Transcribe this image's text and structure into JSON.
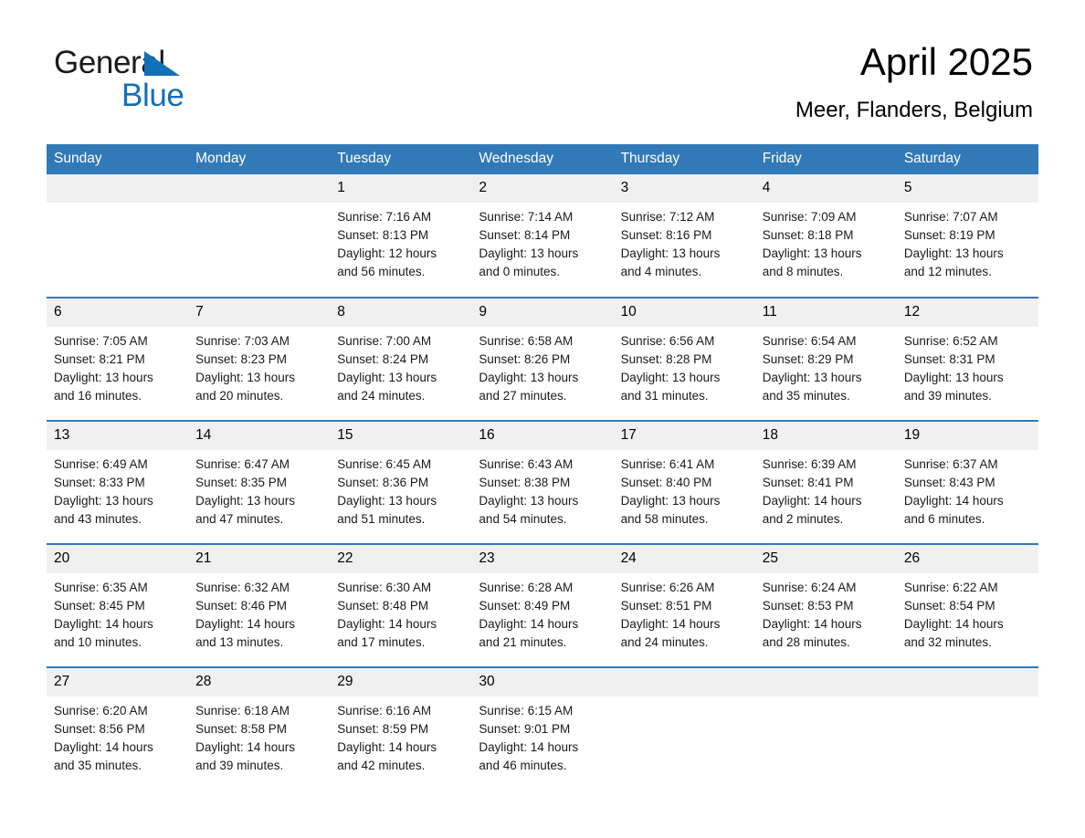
{
  "brand": {
    "logo_line1": "General",
    "logo_line2": "Blue",
    "logo_triangle_icon": "triangle-icon",
    "black": "#1a1a1a",
    "blue": "#1270b8"
  },
  "header": {
    "title": "April 2025",
    "location": "Meer, Flanders, Belgium"
  },
  "colors": {
    "header_blue": "#3279b7",
    "row_divider_blue": "#3279b7",
    "daynum_band": "#f0f0f0",
    "text": "#1a1a1a"
  },
  "weekday_headers": [
    "Sunday",
    "Monday",
    "Tuesday",
    "Wednesday",
    "Thursday",
    "Friday",
    "Saturday"
  ],
  "weeks": [
    [
      {
        "day": "",
        "sunrise": "",
        "sunset": "",
        "daylight_line1": "",
        "daylight_line2": ""
      },
      {
        "day": "",
        "sunrise": "",
        "sunset": "",
        "daylight_line1": "",
        "daylight_line2": ""
      },
      {
        "day": "1",
        "sunrise": "Sunrise: 7:16 AM",
        "sunset": "Sunset: 8:13 PM",
        "daylight_line1": "Daylight: 12 hours",
        "daylight_line2": "and 56 minutes."
      },
      {
        "day": "2",
        "sunrise": "Sunrise: 7:14 AM",
        "sunset": "Sunset: 8:14 PM",
        "daylight_line1": "Daylight: 13 hours",
        "daylight_line2": "and 0 minutes."
      },
      {
        "day": "3",
        "sunrise": "Sunrise: 7:12 AM",
        "sunset": "Sunset: 8:16 PM",
        "daylight_line1": "Daylight: 13 hours",
        "daylight_line2": "and 4 minutes."
      },
      {
        "day": "4",
        "sunrise": "Sunrise: 7:09 AM",
        "sunset": "Sunset: 8:18 PM",
        "daylight_line1": "Daylight: 13 hours",
        "daylight_line2": "and 8 minutes."
      },
      {
        "day": "5",
        "sunrise": "Sunrise: 7:07 AM",
        "sunset": "Sunset: 8:19 PM",
        "daylight_line1": "Daylight: 13 hours",
        "daylight_line2": "and 12 minutes."
      }
    ],
    [
      {
        "day": "6",
        "sunrise": "Sunrise: 7:05 AM",
        "sunset": "Sunset: 8:21 PM",
        "daylight_line1": "Daylight: 13 hours",
        "daylight_line2": "and 16 minutes."
      },
      {
        "day": "7",
        "sunrise": "Sunrise: 7:03 AM",
        "sunset": "Sunset: 8:23 PM",
        "daylight_line1": "Daylight: 13 hours",
        "daylight_line2": "and 20 minutes."
      },
      {
        "day": "8",
        "sunrise": "Sunrise: 7:00 AM",
        "sunset": "Sunset: 8:24 PM",
        "daylight_line1": "Daylight: 13 hours",
        "daylight_line2": "and 24 minutes."
      },
      {
        "day": "9",
        "sunrise": "Sunrise: 6:58 AM",
        "sunset": "Sunset: 8:26 PM",
        "daylight_line1": "Daylight: 13 hours",
        "daylight_line2": "and 27 minutes."
      },
      {
        "day": "10",
        "sunrise": "Sunrise: 6:56 AM",
        "sunset": "Sunset: 8:28 PM",
        "daylight_line1": "Daylight: 13 hours",
        "daylight_line2": "and 31 minutes."
      },
      {
        "day": "11",
        "sunrise": "Sunrise: 6:54 AM",
        "sunset": "Sunset: 8:29 PM",
        "daylight_line1": "Daylight: 13 hours",
        "daylight_line2": "and 35 minutes."
      },
      {
        "day": "12",
        "sunrise": "Sunrise: 6:52 AM",
        "sunset": "Sunset: 8:31 PM",
        "daylight_line1": "Daylight: 13 hours",
        "daylight_line2": "and 39 minutes."
      }
    ],
    [
      {
        "day": "13",
        "sunrise": "Sunrise: 6:49 AM",
        "sunset": "Sunset: 8:33 PM",
        "daylight_line1": "Daylight: 13 hours",
        "daylight_line2": "and 43 minutes."
      },
      {
        "day": "14",
        "sunrise": "Sunrise: 6:47 AM",
        "sunset": "Sunset: 8:35 PM",
        "daylight_line1": "Daylight: 13 hours",
        "daylight_line2": "and 47 minutes."
      },
      {
        "day": "15",
        "sunrise": "Sunrise: 6:45 AM",
        "sunset": "Sunset: 8:36 PM",
        "daylight_line1": "Daylight: 13 hours",
        "daylight_line2": "and 51 minutes."
      },
      {
        "day": "16",
        "sunrise": "Sunrise: 6:43 AM",
        "sunset": "Sunset: 8:38 PM",
        "daylight_line1": "Daylight: 13 hours",
        "daylight_line2": "and 54 minutes."
      },
      {
        "day": "17",
        "sunrise": "Sunrise: 6:41 AM",
        "sunset": "Sunset: 8:40 PM",
        "daylight_line1": "Daylight: 13 hours",
        "daylight_line2": "and 58 minutes."
      },
      {
        "day": "18",
        "sunrise": "Sunrise: 6:39 AM",
        "sunset": "Sunset: 8:41 PM",
        "daylight_line1": "Daylight: 14 hours",
        "daylight_line2": "and 2 minutes."
      },
      {
        "day": "19",
        "sunrise": "Sunrise: 6:37 AM",
        "sunset": "Sunset: 8:43 PM",
        "daylight_line1": "Daylight: 14 hours",
        "daylight_line2": "and 6 minutes."
      }
    ],
    [
      {
        "day": "20",
        "sunrise": "Sunrise: 6:35 AM",
        "sunset": "Sunset: 8:45 PM",
        "daylight_line1": "Daylight: 14 hours",
        "daylight_line2": "and 10 minutes."
      },
      {
        "day": "21",
        "sunrise": "Sunrise: 6:32 AM",
        "sunset": "Sunset: 8:46 PM",
        "daylight_line1": "Daylight: 14 hours",
        "daylight_line2": "and 13 minutes."
      },
      {
        "day": "22",
        "sunrise": "Sunrise: 6:30 AM",
        "sunset": "Sunset: 8:48 PM",
        "daylight_line1": "Daylight: 14 hours",
        "daylight_line2": "and 17 minutes."
      },
      {
        "day": "23",
        "sunrise": "Sunrise: 6:28 AM",
        "sunset": "Sunset: 8:49 PM",
        "daylight_line1": "Daylight: 14 hours",
        "daylight_line2": "and 21 minutes."
      },
      {
        "day": "24",
        "sunrise": "Sunrise: 6:26 AM",
        "sunset": "Sunset: 8:51 PM",
        "daylight_line1": "Daylight: 14 hours",
        "daylight_line2": "and 24 minutes."
      },
      {
        "day": "25",
        "sunrise": "Sunrise: 6:24 AM",
        "sunset": "Sunset: 8:53 PM",
        "daylight_line1": "Daylight: 14 hours",
        "daylight_line2": "and 28 minutes."
      },
      {
        "day": "26",
        "sunrise": "Sunrise: 6:22 AM",
        "sunset": "Sunset: 8:54 PM",
        "daylight_line1": "Daylight: 14 hours",
        "daylight_line2": "and 32 minutes."
      }
    ],
    [
      {
        "day": "27",
        "sunrise": "Sunrise: 6:20 AM",
        "sunset": "Sunset: 8:56 PM",
        "daylight_line1": "Daylight: 14 hours",
        "daylight_line2": "and 35 minutes."
      },
      {
        "day": "28",
        "sunrise": "Sunrise: 6:18 AM",
        "sunset": "Sunset: 8:58 PM",
        "daylight_line1": "Daylight: 14 hours",
        "daylight_line2": "and 39 minutes."
      },
      {
        "day": "29",
        "sunrise": "Sunrise: 6:16 AM",
        "sunset": "Sunset: 8:59 PM",
        "daylight_line1": "Daylight: 14 hours",
        "daylight_line2": "and 42 minutes."
      },
      {
        "day": "30",
        "sunrise": "Sunrise: 6:15 AM",
        "sunset": "Sunset: 9:01 PM",
        "daylight_line1": "Daylight: 14 hours",
        "daylight_line2": "and 46 minutes."
      },
      {
        "day": "",
        "sunrise": "",
        "sunset": "",
        "daylight_line1": "",
        "daylight_line2": ""
      },
      {
        "day": "",
        "sunrise": "",
        "sunset": "",
        "daylight_line1": "",
        "daylight_line2": ""
      },
      {
        "day": "",
        "sunrise": "",
        "sunset": "",
        "daylight_line1": "",
        "daylight_line2": ""
      }
    ]
  ]
}
